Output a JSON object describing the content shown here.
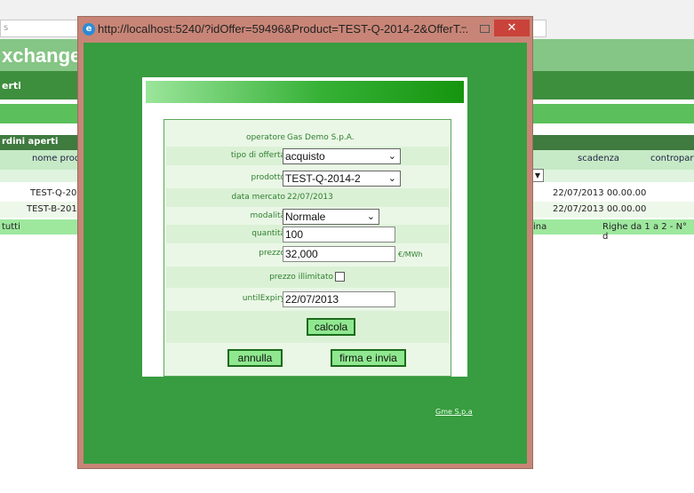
{
  "background": {
    "address_fragment": "s",
    "app_title": "xchange",
    "nav_label": "erti",
    "grid_title": "rdini aperti",
    "columns": {
      "product": "nome prod",
      "expiry": "scadenza",
      "counterpart": "contropart"
    },
    "rows": [
      {
        "product": "TEST-Q-20",
        "expiry": "22/07/2013 00.00.00"
      },
      {
        "product": "TEST-B-201",
        "expiry": "22/07/2013 00.00.00"
      }
    ],
    "footer": {
      "filter": "tutti",
      "page": "ina",
      "range": "Righe da 1 a 2 - N° d"
    }
  },
  "window": {
    "url": "http://localhost:5240/?idOffer=59496&Product=TEST-Q-2014-2&OfferT...",
    "minimize": "–",
    "close": "✕"
  },
  "form": {
    "operator_label": "operatore",
    "operator_value": "Gas Demo S.p.A.",
    "offer_type_label": "tipo di offerta",
    "offer_type_value": "acquisto",
    "product_label": "prodotto",
    "product_value": "TEST-Q-2014-2",
    "market_date_label": "data mercato",
    "market_date_value": "22/07/2013",
    "mode_label": "modalità",
    "mode_value": "Normale",
    "quantity_label": "quantità",
    "quantity_value": "100",
    "price_label": "prezzo",
    "price_value": "32,000",
    "price_unit": "€/MWh",
    "unlimited_price_label": "prezzo illimitato",
    "unlimited_price_checked": false,
    "until_expiry_label": "untilExpiry",
    "until_expiry_value": "22/07/2013",
    "calculate_button": "calcola",
    "cancel_button": "annulla",
    "sign_send_button": "firma e invia"
  },
  "footer_link": "Gme S.p.a",
  "icons": {
    "browser": "ie-icon",
    "dropdown": "chevron-down-icon"
  },
  "colors": {
    "window_frame": "#c88577",
    "client_bg": "#389c40",
    "form_bg": "#eaf7e6",
    "label_green": "#2f7f2f",
    "close_red": "#c9433a"
  }
}
